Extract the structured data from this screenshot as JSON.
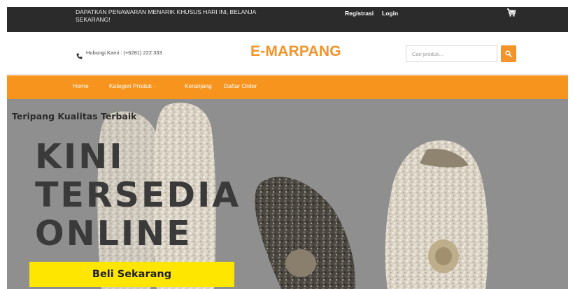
{
  "topbar": {
    "promo_text": "DAPATKAN PENAWARAN MENARIK KHUSUS HARI INI, BELANJA SEKARANG!",
    "register_label": "Registrasi",
    "login_label": "Login",
    "cart_icon": "cart-icon"
  },
  "header": {
    "contact_text": "Hubungi Kami : (+6281) 222 333",
    "phone_icon": "phone-icon",
    "brand": "E-MARPANG",
    "search_placeholder": "Cari produk...",
    "search_icon": "search-icon"
  },
  "nav": {
    "items": [
      {
        "label": "Home"
      },
      {
        "label": "Kategori Produk -"
      },
      {
        "label": "Keranjang"
      },
      {
        "label": "Daftar Order"
      }
    ]
  },
  "hero": {
    "tagline": "Teripang Kualitas Terbaik",
    "headline": [
      "KINI",
      "TERSEDIA",
      "ONLINE"
    ],
    "cta_label": "Beli Sekarang"
  },
  "colors": {
    "accent": "#f7941e",
    "topbar_bg": "#2b2b2b",
    "hero_bg": "#8f8f8f",
    "cta_bg": "#ffe600"
  }
}
